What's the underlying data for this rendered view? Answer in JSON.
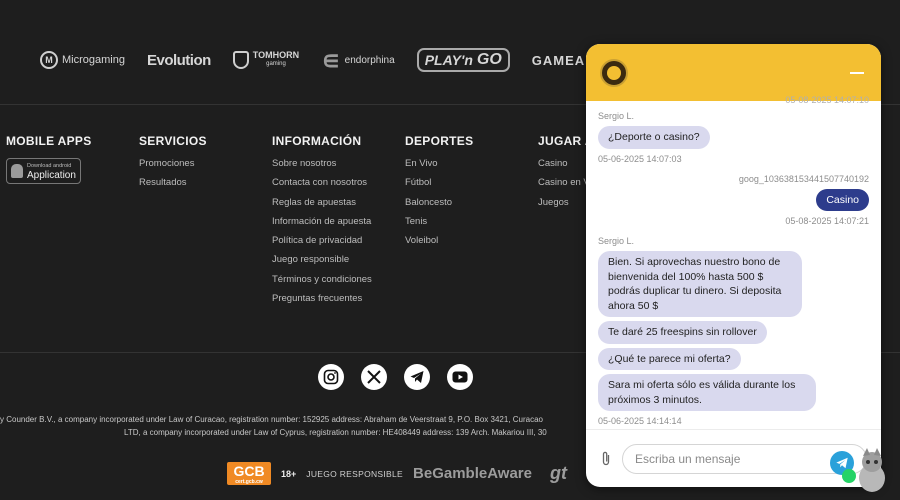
{
  "providers": {
    "microgaming": "Microgaming",
    "evolution": "Evolution",
    "tomhorn": "TOMHORN",
    "tomhorn_sub": "gaming",
    "endorphina": "endorphina",
    "playngo_a": "PLAY'n",
    "playngo_b": "GO",
    "gameart": "GAMEART"
  },
  "footer": {
    "mobile": {
      "title": "MOBILE APPS",
      "badge_small": "Download android",
      "badge_big": "Application"
    },
    "servicios": {
      "title": "SERVICIOS",
      "links": [
        "Promociones",
        "Resultados"
      ]
    },
    "informacion": {
      "title": "INFORMACIÓN",
      "links": [
        "Sobre nosotros",
        "Contacta con nosotros",
        "Reglas de apuestas",
        "Información de apuesta",
        "Política de privacidad",
        "Juego responsible",
        "Términos y condiciones",
        "Preguntas frecuentes"
      ]
    },
    "deportes": {
      "title": "DEPORTES",
      "links": [
        "En Vivo",
        "Fútbol",
        "Baloncesto",
        "Tenis",
        "Voleibol"
      ]
    },
    "jugar": {
      "title": "JUGAR A",
      "links": [
        "Casino",
        "Casino en V",
        "Juegos"
      ]
    }
  },
  "social": [
    "instagram-icon",
    "x-icon",
    "telegram-icon",
    "youtube-icon"
  ],
  "legal": {
    "line1": "y Counder B.V., a company incorporated under Law of Curacao, registration number: 152925 address: Abraham de Veerstraat 9, P.O. Box 3421, Curacao",
    "line2": "LTD, a company incorporated under Law of Cyprus, registration number: HE408449 address: 139 Arch. Makariou III, 30"
  },
  "bottom": {
    "gcb": "GCB",
    "gcb_sub": "cert.gcb.cw",
    "age": "18+",
    "responsible": "JUEGO RESPONSIBLE",
    "gamble_aware": "BeGambleAware",
    "gt": "gt"
  },
  "chat": {
    "top_partial_time": "05-08-2025 14:07:10",
    "messages": [
      {
        "sender": "Sergio L.",
        "texts": [
          "¿Deporte o casino?"
        ],
        "time": "05-06-2025 14:07:03"
      },
      {
        "sender": "goog_1036381534415077401​92",
        "texts": [
          "Casino"
        ],
        "time": "05-08-2025 14:07:21"
      },
      {
        "sender": "Sergio L.",
        "texts": [
          "Bien. Si aprovechas nuestro bono de bienvenida del 100% hasta 500 $ podrás duplicar tu dinero. Si deposita ahora 50 $",
          "Te daré 25 freespins sin rollover",
          "¿Qué te parece mi oferta?",
          "Sara mi oferta sólo es válida durante los próximos 3 minutos."
        ],
        "time": "05-06-2025 14:14:14"
      }
    ],
    "placeholder": "Escriba un mensaje"
  },
  "colors": {
    "accent": "#f3bf32",
    "my_bubble": "#2d3c8c",
    "their_bubble": "#d9d9ee",
    "bg": "#1e1e1e"
  }
}
